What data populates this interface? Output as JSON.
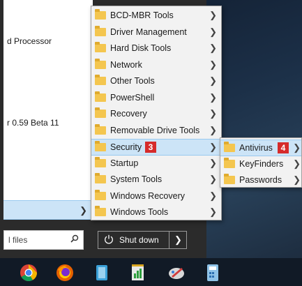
{
  "start_menu": {
    "programs": [
      {
        "text": "d Processor"
      },
      {
        "text": "r 0.59 Beta 11"
      }
    ],
    "search": {
      "placeholder": "l files"
    },
    "shutdown": {
      "label": "Shut down"
    }
  },
  "submenu_main": {
    "items": [
      {
        "label": "BCD-MBR Tools"
      },
      {
        "label": "Driver Management"
      },
      {
        "label": "Hard Disk Tools"
      },
      {
        "label": "Network"
      },
      {
        "label": "Other Tools"
      },
      {
        "label": "PowerShell"
      },
      {
        "label": "Recovery"
      },
      {
        "label": "Removable Drive Tools"
      },
      {
        "label": "Security",
        "badge": "3"
      },
      {
        "label": "Startup"
      },
      {
        "label": "System Tools"
      },
      {
        "label": "Windows Recovery"
      },
      {
        "label": "Windows Tools"
      }
    ]
  },
  "submenu_security": {
    "items": [
      {
        "label": "Antivirus",
        "badge": "4"
      },
      {
        "label": "KeyFinders"
      },
      {
        "label": "Passwords"
      }
    ]
  },
  "taskbar": {
    "icons": [
      "chrome-icon",
      "firefox-icon",
      "notebook-app-icon",
      "notepad-chart-icon",
      "paint-tool-icon",
      "calculator-icon"
    ]
  }
}
